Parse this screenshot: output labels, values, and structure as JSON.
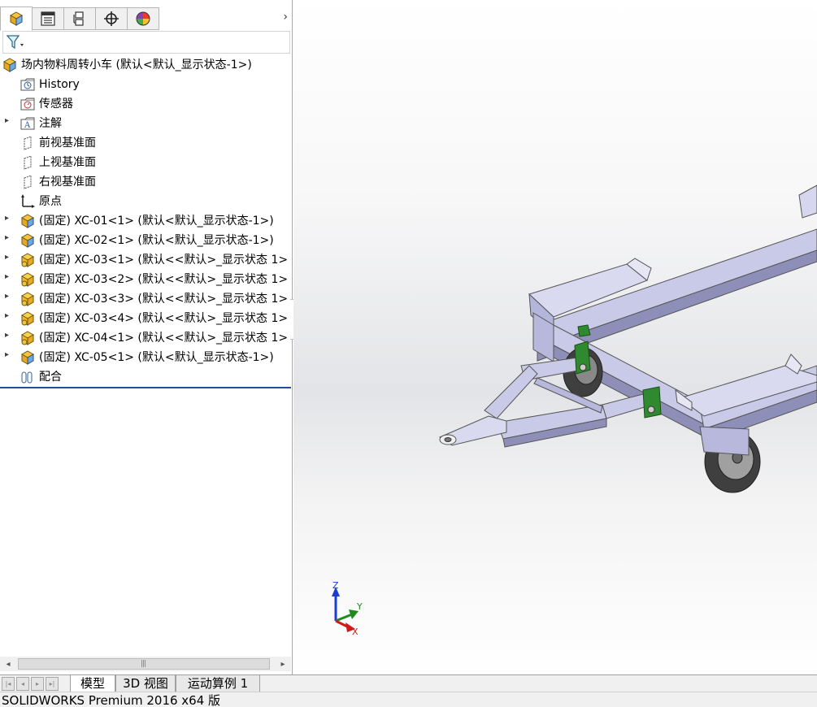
{
  "feature_tree": {
    "tabs": [
      {
        "name": "feature-manager",
        "icon": "part-cube-icon"
      },
      {
        "name": "property-manager",
        "icon": "list-icon"
      },
      {
        "name": "configuration-manager",
        "icon": "configuration-icon"
      },
      {
        "name": "dimxpert-manager",
        "icon": "crosshair-icon"
      },
      {
        "name": "display-manager",
        "icon": "color-wheel-icon"
      }
    ],
    "more_arrow": "›",
    "filter_icon": "filter-icon",
    "root_label": "场内物料周转小车  (默认<默认_显示状态-1>)",
    "items": [
      {
        "label": "History",
        "icon": "history-folder-icon",
        "expandable": false
      },
      {
        "label": "传感器",
        "icon": "sensor-folder-icon",
        "expandable": false
      },
      {
        "label": "注解",
        "icon": "annotation-folder-icon",
        "expandable": true
      },
      {
        "label": "前视基准面",
        "icon": "plane-icon",
        "expandable": false
      },
      {
        "label": "上视基准面",
        "icon": "plane-icon",
        "expandable": false
      },
      {
        "label": "右视基准面",
        "icon": "plane-icon",
        "expandable": false
      },
      {
        "label": "原点",
        "icon": "origin-icon",
        "expandable": false
      },
      {
        "label": "(固定) XC-01<1> (默认<默认_显示状态-1>)",
        "icon": "assembly-part-icon",
        "expandable": true
      },
      {
        "label": "(固定) XC-02<1> (默认<默认_显示状态-1>)",
        "icon": "assembly-part-icon",
        "expandable": true
      },
      {
        "label": "(固定) XC-03<1> (默认<<默认>_显示状态 1>",
        "icon": "part-icon",
        "expandable": true
      },
      {
        "label": "(固定) XC-03<2> (默认<<默认>_显示状态 1>",
        "icon": "part-icon",
        "expandable": true
      },
      {
        "label": "(固定) XC-03<3> (默认<<默认>_显示状态 1>",
        "icon": "part-icon",
        "expandable": true
      },
      {
        "label": "(固定) XC-03<4> (默认<<默认>_显示状态 1>",
        "icon": "part-icon",
        "expandable": true
      },
      {
        "label": "(固定) XC-04<1> (默认<<默认>_显示状态 1>",
        "icon": "part-icon",
        "expandable": true
      },
      {
        "label": "(固定) XC-05<1> (默认<默认_显示状态-1>)",
        "icon": "assembly-part-icon",
        "expandable": true
      },
      {
        "label": "配合",
        "icon": "mates-icon",
        "expandable": false
      }
    ]
  },
  "scrollbar": {
    "left_arrow": "◂",
    "right_arrow": "▸",
    "grip": "|||"
  },
  "triad": {
    "z": "Z",
    "y": "Y",
    "x": "X"
  },
  "bottom_tabs": {
    "nav_buttons": [
      "|◂",
      "◂",
      "▸",
      "▸|"
    ],
    "tabs": [
      {
        "label": "模型",
        "active": true
      },
      {
        "label": "3D 视图",
        "active": false
      },
      {
        "label": "运动算例 1",
        "active": false
      }
    ]
  },
  "status_bar": {
    "text": "SOLIDWORKS Premium 2016 x64 版"
  },
  "colors": {
    "frame": "#c9c9e8",
    "frame_dark": "#8e8fb8",
    "bracket": "#2f8a2f",
    "wheel": "#3f3f3f",
    "tree_divider": "#1f4e99"
  }
}
